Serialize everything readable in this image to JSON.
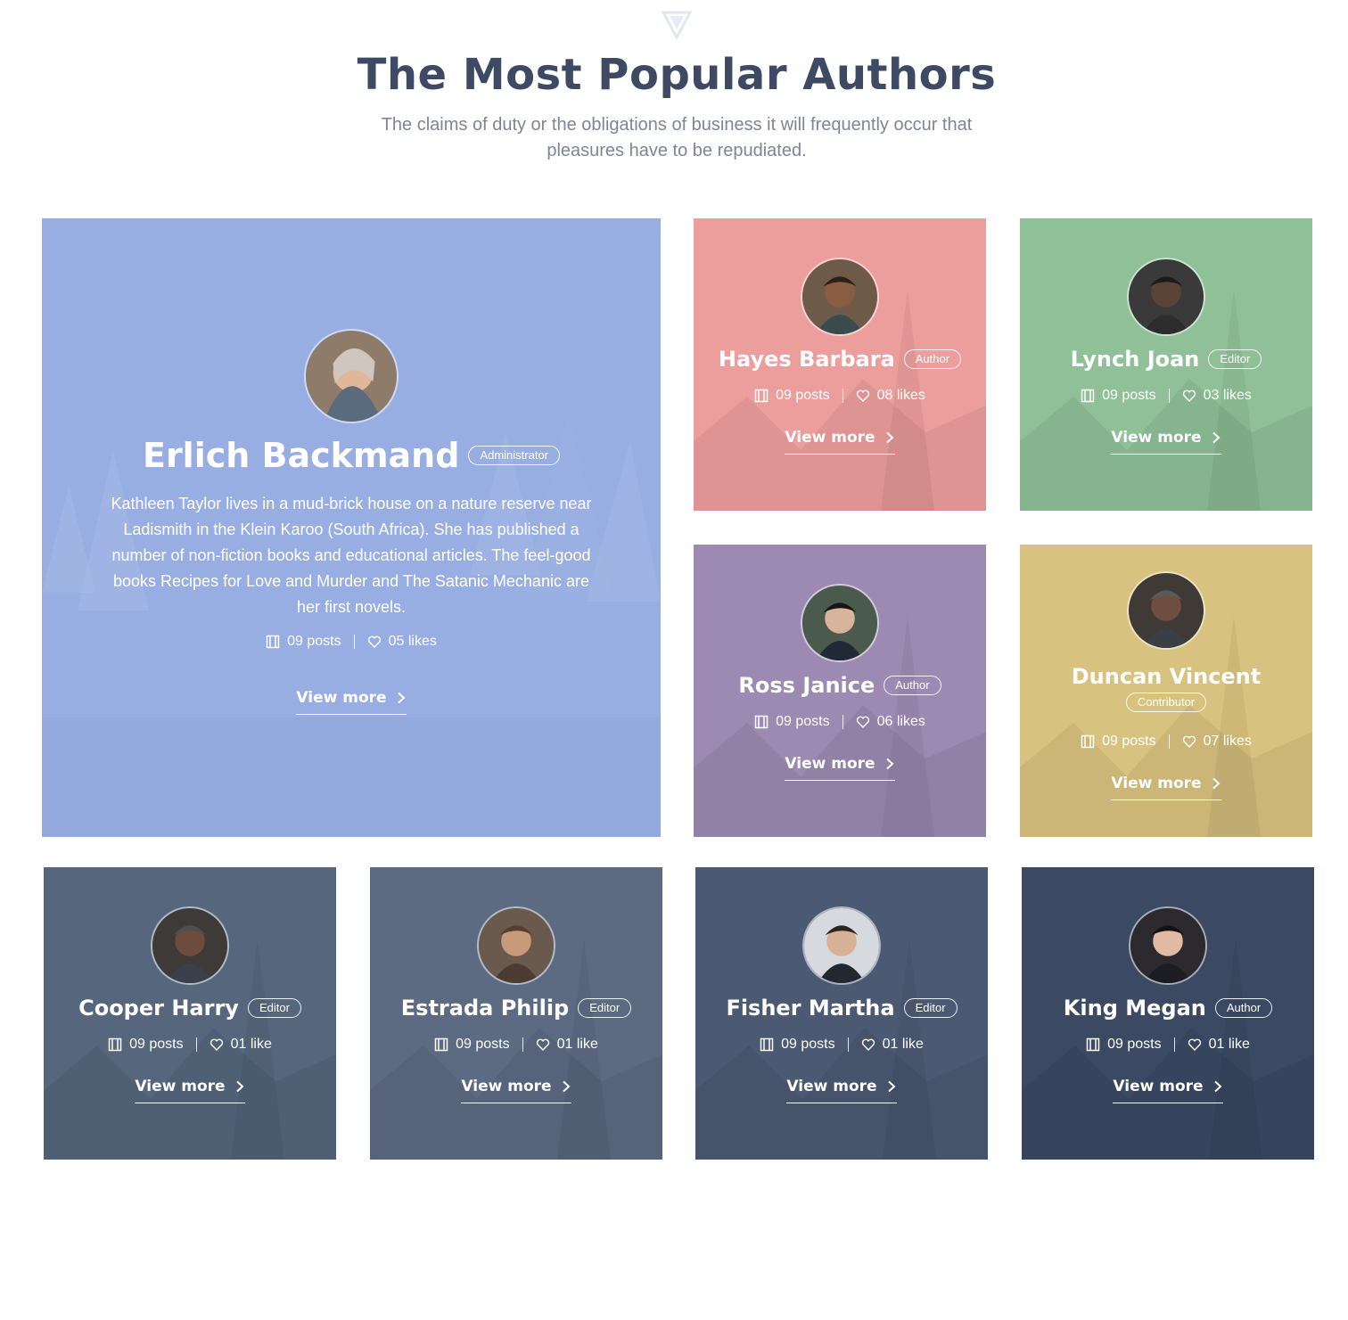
{
  "header": {
    "logo_icon": "triangle-logo-icon",
    "title": "The Most Popular Authors",
    "subtitle": "The claims of duty or the obligations of business it will frequently occur that pleasures have to be repudiated."
  },
  "icons": {
    "posts": "film-icon",
    "likes": "heart-icon",
    "arrow": "chevron-right-icon"
  },
  "featured": {
    "name": "Erlich Backmand",
    "role": "Administrator",
    "bio": "Kathleen Taylor lives in a mud-brick house on a nature reserve near Ladismith in the Klein Karoo (South Africa). She has published a number of non-fiction books and educational articles. The feel-good books Recipes for Love and Murder and The Satanic Mechanic are her first novels.",
    "posts": "09 posts",
    "likes": "05 likes",
    "cta": "View more",
    "color": "#98aee2"
  },
  "authors": [
    {
      "name": "Hayes Barbara",
      "role": "Author",
      "posts": "09 posts",
      "likes": "08 likes",
      "cta": "View more",
      "color": "#eb9e9c"
    },
    {
      "name": "Lynch Joan",
      "role": "Editor",
      "posts": "09 posts",
      "likes": "03 likes",
      "cta": "View more",
      "color": "#8fc097"
    },
    {
      "name": "Ross Janice",
      "role": "Author",
      "posts": "09 posts",
      "likes": "06 likes",
      "cta": "View more",
      "color": "#9c8ab2"
    },
    {
      "name": "Duncan Vincent",
      "role": "Contributor",
      "posts": "09 posts",
      "likes": "07 likes",
      "cta": "View more",
      "color": "#d8c27f"
    },
    {
      "name": "Cooper Harry",
      "role": "Editor",
      "posts": "09 posts",
      "likes": "01 like",
      "cta": "View more",
      "color": "#56667c"
    },
    {
      "name": "Estrada Philip",
      "role": "Editor",
      "posts": "09 posts",
      "likes": "01 like",
      "cta": "View more",
      "color": "#5c6a82"
    },
    {
      "name": "Fisher Martha",
      "role": "Editor",
      "posts": "09 posts",
      "likes": "01 like",
      "cta": "View more",
      "color": "#4b5972"
    },
    {
      "name": "King Megan",
      "role": "Author",
      "posts": "09 posts",
      "likes": "01 like",
      "cta": "View more",
      "color": "#3b4963"
    }
  ]
}
